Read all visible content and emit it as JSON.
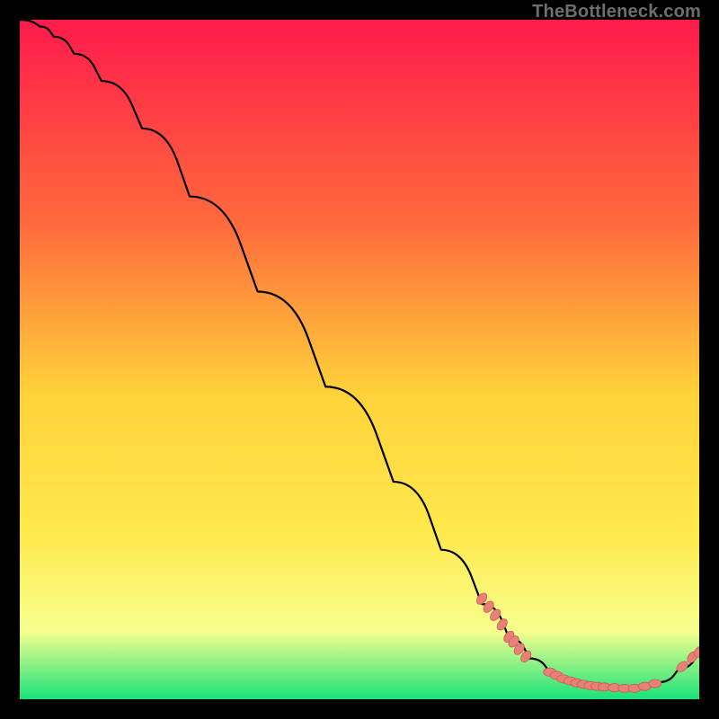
{
  "watermark": "TheBottleneck.com",
  "colors": {
    "bg": "#000000",
    "grad_top": "#ff1a4b",
    "grad_mid1": "#ff6a3c",
    "grad_mid2": "#ffd23a",
    "grad_yellow": "#ffe84a",
    "grad_pale": "#f6ff8e",
    "grad_green": "#19e27a",
    "curve": "#000000",
    "dot_fill": "#e98077",
    "dot_stroke": "#c95b52"
  },
  "chart_data": {
    "type": "line",
    "title": "",
    "xlabel": "",
    "ylabel": "",
    "xlim": [
      0,
      100
    ],
    "ylim": [
      0,
      100
    ],
    "grid": false,
    "legend": false,
    "series": [
      {
        "name": "bottleneck-curve",
        "x": [
          0,
          3,
          5,
          8,
          12,
          18,
          25,
          35,
          45,
          55,
          62,
          68,
          72,
          75,
          78,
          80,
          83,
          86,
          90,
          94,
          97,
          100
        ],
        "y": [
          100,
          99,
          97.5,
          95,
          91,
          84,
          74,
          60,
          46,
          32,
          22,
          14,
          9,
          6,
          4,
          3,
          2.2,
          1.8,
          1.6,
          2.5,
          4.5,
          7
        ]
      }
    ],
    "clusters": [
      {
        "name": "upper-slope-dots",
        "points": [
          {
            "x": 68,
            "y": 14.8
          },
          {
            "x": 69,
            "y": 13.6
          },
          {
            "x": 70,
            "y": 12.4
          },
          {
            "x": 71,
            "y": 11
          },
          {
            "x": 72,
            "y": 9.2
          },
          {
            "x": 72.7,
            "y": 8.5
          },
          {
            "x": 73.5,
            "y": 7.4
          },
          {
            "x": 74.5,
            "y": 6.3
          }
        ]
      },
      {
        "name": "valley-dots",
        "points": [
          {
            "x": 78,
            "y": 4.0
          },
          {
            "x": 79,
            "y": 3.5
          },
          {
            "x": 80,
            "y": 3.0
          },
          {
            "x": 81,
            "y": 2.7
          },
          {
            "x": 82,
            "y": 2.4
          },
          {
            "x": 83,
            "y": 2.2
          },
          {
            "x": 84,
            "y": 2.0
          },
          {
            "x": 85,
            "y": 1.9
          },
          {
            "x": 86,
            "y": 1.8
          },
          {
            "x": 87.5,
            "y": 1.7
          },
          {
            "x": 89,
            "y": 1.6
          },
          {
            "x": 90.5,
            "y": 1.6
          },
          {
            "x": 92,
            "y": 1.9
          },
          {
            "x": 93.5,
            "y": 2.3
          }
        ]
      },
      {
        "name": "tail-dots",
        "points": [
          {
            "x": 97.5,
            "y": 4.8
          },
          {
            "x": 99,
            "y": 6.2
          },
          {
            "x": 100,
            "y": 7.0
          }
        ]
      }
    ]
  }
}
